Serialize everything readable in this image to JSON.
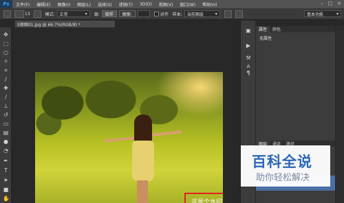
{
  "app": {
    "logo": "Ps",
    "menu": [
      "文件(F)",
      "编辑(E)",
      "图像(I)",
      "图层(L)",
      "选择(S)",
      "滤镜(T)",
      "3D(D)",
      "视图(V)",
      "窗口(W)",
      "帮助(H)"
    ],
    "window_controls": [
      "–",
      "□",
      "×"
    ]
  },
  "options_bar": {
    "size_value": "13",
    "mode_label": "模式:",
    "mode_value": "正常",
    "sample_label": "源:",
    "source_btn": "取样",
    "pattern_btn": "图案:",
    "align_label": "对齐",
    "sample_layer_label": "样本:",
    "sample_layer_value": "当前图层",
    "workspace_value": "基本功能"
  },
  "document": {
    "tab_title": "5原图01.jpg @ 66.7%(RGB/8) *",
    "watermark_text": "这是个水印"
  },
  "properties_panel": {
    "tabs": [
      "属性",
      "颜色"
    ],
    "content": "无属性"
  },
  "layers_panel": {
    "tabs": [
      "图层",
      "通道",
      "路径"
    ]
  },
  "overlay": {
    "title": "百科全说",
    "subtitle": "助你轻松解决"
  },
  "tools": [
    "move-tool",
    "marquee-tool",
    "lasso-tool",
    "magic-wand-tool",
    "crop-tool",
    "eyedropper-tool",
    "healing-tool",
    "brush-tool",
    "clone-stamp-tool",
    "history-brush-tool",
    "eraser-tool",
    "gradient-tool",
    "blur-tool",
    "dodge-tool",
    "pen-tool",
    "type-tool",
    "path-select-tool",
    "shape-tool",
    "hand-tool"
  ],
  "colors": {
    "accent": "#2b67b6",
    "watermark_box": "#e02020"
  }
}
